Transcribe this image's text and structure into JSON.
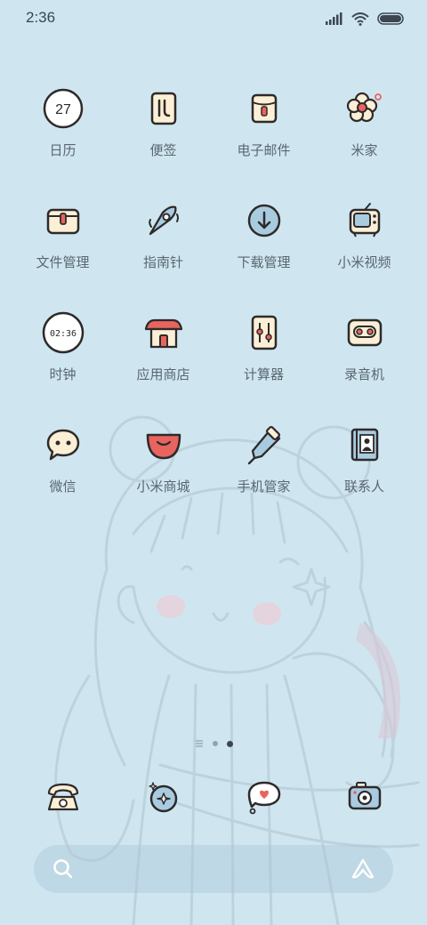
{
  "status_bar": {
    "time": "2:36",
    "icons": [
      "signal-icon",
      "wifi-icon",
      "battery-icon"
    ]
  },
  "apps": [
    {
      "label": "日历",
      "icon": "calendar-icon",
      "badge_text": "27"
    },
    {
      "label": "便签",
      "icon": "notes-icon"
    },
    {
      "label": "电子邮件",
      "icon": "email-icon"
    },
    {
      "label": "米家",
      "icon": "flower-icon"
    },
    {
      "label": "文件管理",
      "icon": "folder-icon"
    },
    {
      "label": "指南针",
      "icon": "compass-icon"
    },
    {
      "label": "下载管理",
      "icon": "download-icon"
    },
    {
      "label": "小米视频",
      "icon": "tv-icon"
    },
    {
      "label": "时钟",
      "icon": "clock-icon",
      "badge_text": "02:36"
    },
    {
      "label": "应用商店",
      "icon": "store-house-icon"
    },
    {
      "label": "计算器",
      "icon": "calculator-icon"
    },
    {
      "label": "录音机",
      "icon": "recorder-icon"
    },
    {
      "label": "微信",
      "icon": "chat-bubble-icon"
    },
    {
      "label": "小米商城",
      "icon": "shopping-bag-icon"
    },
    {
      "label": "手机管家",
      "icon": "security-icon"
    },
    {
      "label": "联系人",
      "icon": "contacts-icon"
    }
  ],
  "page_indicator": {
    "pages": 3,
    "current": 2
  },
  "dock": [
    {
      "icon": "phone-icon"
    },
    {
      "icon": "browser-icon"
    },
    {
      "icon": "messages-icon"
    },
    {
      "icon": "camera-icon"
    }
  ],
  "search_bar": {
    "placeholder": "",
    "left_icon": "search-icon",
    "right_icon": "assistant-icon"
  },
  "colors": {
    "background": "#cfe6f0",
    "icon_stroke": "#2e2a2a",
    "icon_cream": "#fbefd6",
    "icon_red": "#e8645f",
    "icon_blue": "#a9cbe0",
    "label": "#5a6670"
  }
}
